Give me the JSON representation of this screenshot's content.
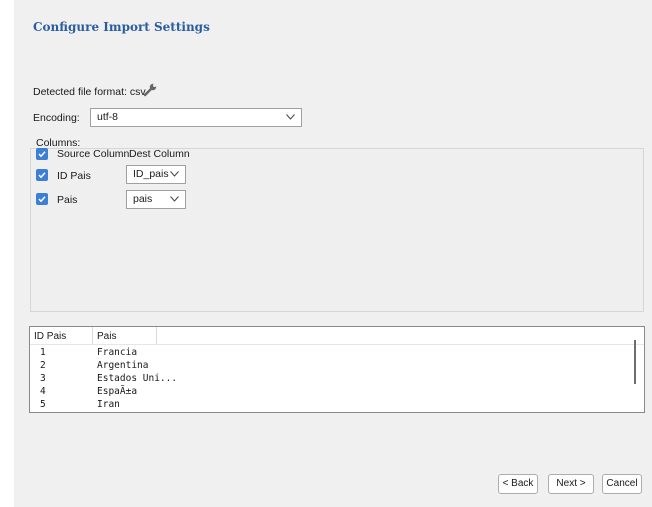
{
  "dialog": {
    "title": "Configure Import Settings",
    "detected_format_label": "Detected file format: csv",
    "encoding_label": "Encoding:",
    "encoding_value": "utf-8",
    "columns_label": "Columns:",
    "col_headers": {
      "source": "Source Column",
      "dest": "Dest Column"
    },
    "column_rows": [
      {
        "checked": true,
        "source": "ID Pais",
        "dest": "ID_pais"
      },
      {
        "checked": true,
        "source": "Pais",
        "dest": "pais"
      }
    ],
    "header_checkbox_checked": true
  },
  "preview": {
    "headers": [
      "ID Pais",
      "Pais"
    ],
    "rows": [
      [
        "1",
        "Francia"
      ],
      [
        "2",
        "Argentina"
      ],
      [
        "3",
        "Estados Uni..."
      ],
      [
        "4",
        "EspaÃ±a"
      ],
      [
        "5",
        "Iran"
      ]
    ]
  },
  "buttons": {
    "back": "< Back",
    "next": "Next >",
    "cancel": "Cancel"
  },
  "colors": {
    "title": "#2a5d9f",
    "checkbox": "#3c7fd6"
  },
  "icons": {
    "format": "wrench-icon",
    "dropdown": "chevron-down-icon",
    "check": "check-icon"
  }
}
